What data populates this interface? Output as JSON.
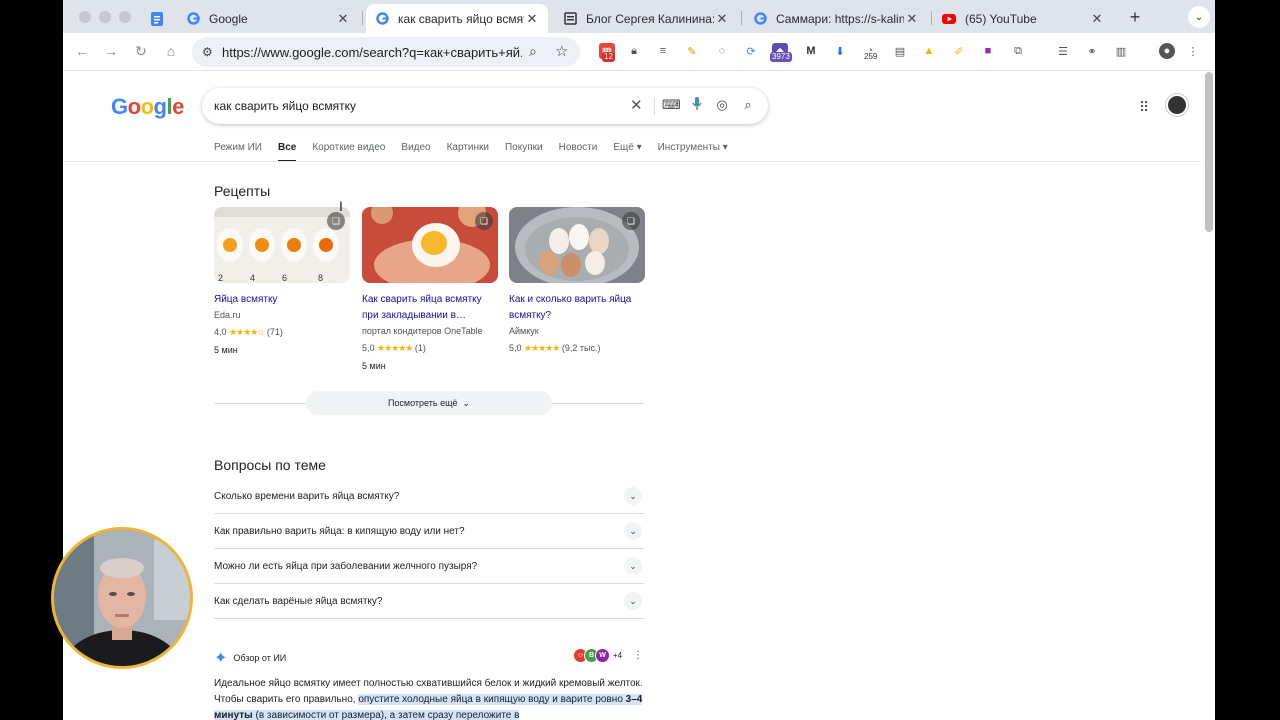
{
  "tabs": [
    {
      "title": "",
      "icon": "docs-icon",
      "active": false
    },
    {
      "title": "Google",
      "icon": "google-icon",
      "active": false
    },
    {
      "title": "как сварить яйцо всмятку",
      "icon": "google-icon",
      "active": true
    },
    {
      "title": "Блог Сергея Калинина: Ма",
      "icon": "blog-icon",
      "active": false
    },
    {
      "title": "Саммари: https://s-kalinin.",
      "icon": "google-icon",
      "active": false
    },
    {
      "title": "(65) YouTube",
      "icon": "youtube-icon",
      "active": false
    }
  ],
  "toolbar": {
    "url": "https://www.google.com/search?q=как+сварить+яй...",
    "badges": {
      "calendar": "12",
      "ext1": "3973",
      "ext2": "259"
    }
  },
  "search": {
    "logo": "Google",
    "query": "как сварить яйцо всмятку"
  },
  "result_tabs": [
    "Режим ИИ",
    "Все",
    "Короткие видео",
    "Видео",
    "Картинки",
    "Покупки",
    "Новости",
    "Ещё",
    "Инструменты"
  ],
  "recipes": {
    "heading": "Рецепты",
    "items": [
      {
        "title": "Яйца всмятку",
        "source": "Eda.ru",
        "rating": "4,0",
        "stars": "★★★★☆",
        "count": "(71)",
        "time": "5 мин"
      },
      {
        "title": "Как сварить яйца всмятку при закладывании в…",
        "source": "портал кондитеров OneTable",
        "rating": "5,0",
        "stars": "★★★★★",
        "count": "(1)",
        "time": "5 мин"
      },
      {
        "title": "Как и сколько варить яйца всмятку?",
        "source": "Аймкук",
        "rating": "5,0",
        "stars": "★★★★★",
        "count": "(9,2 тыс.)",
        "time": ""
      }
    ],
    "thumb_labels": [
      "2",
      "4",
      "6",
      "8"
    ],
    "more": "Посмотреть ещё"
  },
  "faq": {
    "heading": "Вопросы по теме",
    "items": [
      "Сколько времени варить яйца всмятку?",
      "Как правильно варить яйца: в кипящую воду или нет?",
      "Можно ли есть яйца при заболевании желчного пузыря?",
      "Как сделать варёные яйца всмятку?"
    ]
  },
  "ai": {
    "label": "Обзор от ИИ",
    "sources_more": "+4",
    "text1": "Идеальное яйцо всмятку имеет полностью схватившийся белок и жидкий кремовый желток. Чтобы сварить его правильно, ",
    "text2": "опустите холодные яйца в кипящую воду и варите ровно ",
    "text3": "3–4 минуты",
    "text4": " (в зависимости от размера), а затем сразу переложите в"
  },
  "colors": {
    "link": "#1a0dab",
    "star": "#f4b400",
    "highlight": "#d3e3fd",
    "webcam_ring": "#f0b437"
  }
}
